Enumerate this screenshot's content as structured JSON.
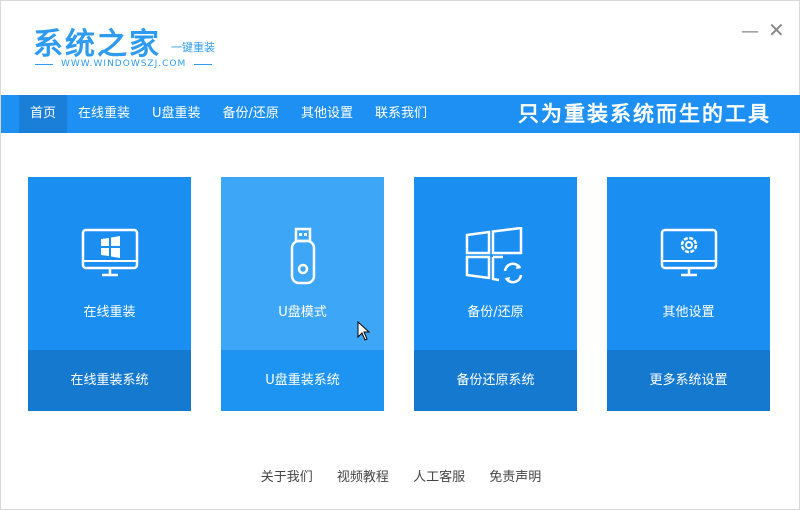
{
  "header": {
    "logo_text": "系统之家",
    "slogan": "一键重装",
    "url": "WWW.WINDOWSZJ.COM",
    "minimize": "—",
    "close": "✕"
  },
  "nav": {
    "items": [
      "首页",
      "在线重装",
      "U盘重装",
      "备份/还原",
      "其他设置",
      "联系我们"
    ],
    "tagline": "只为重装系统而生的工具"
  },
  "cards": [
    {
      "label": "在线重装",
      "action": "在线重装系统",
      "icon": "monitor-windows-icon"
    },
    {
      "label": "U盘模式",
      "action": "U盘重装系统",
      "icon": "usb-drive-icon"
    },
    {
      "label": "备份/还原",
      "action": "备份还原系统",
      "icon": "windows-restore-icon"
    },
    {
      "label": "其他设置",
      "action": "更多系统设置",
      "icon": "monitor-gear-icon"
    }
  ],
  "footer": {
    "links": [
      "关于我们",
      "视频教程",
      "人工客服",
      "免责声明"
    ]
  },
  "colors": {
    "brand": "#1e90f4",
    "card": "#1a8ef1",
    "card_bottom": "#1579cf",
    "card_hover": "#3ea6f7"
  }
}
